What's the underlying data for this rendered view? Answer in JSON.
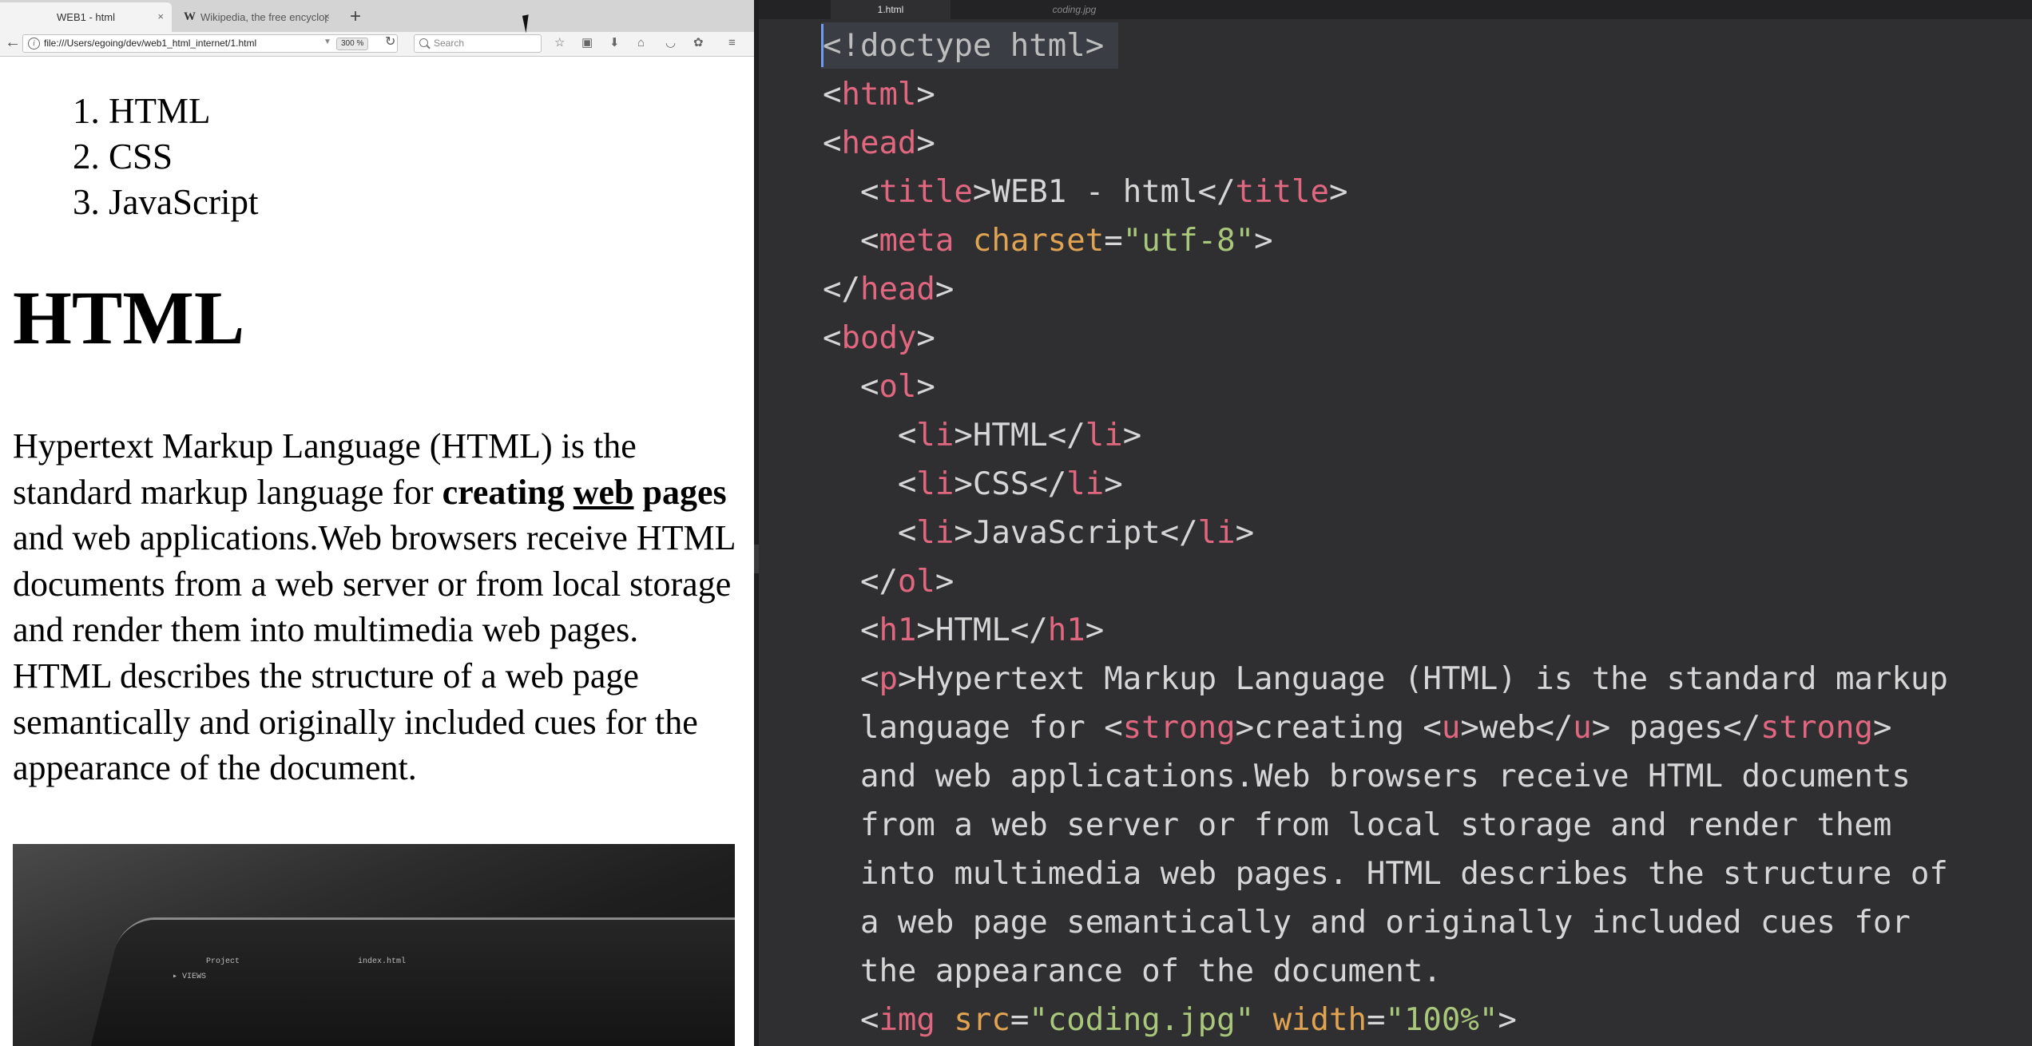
{
  "browser": {
    "tabs": [
      {
        "label": "WEB1 - html",
        "close": "×"
      },
      {
        "label": "Wikipedia, the free encyclope",
        "icon_glyph": "W",
        "close": "×"
      }
    ],
    "new_tab": "+",
    "url": "file:///Users/egoing/dev/web1_html_internet/1.html",
    "zoom": "300 %",
    "search_placeholder": "Search",
    "toolbar_icons": [
      "star-icon",
      "clipboard-icon",
      "download-icon",
      "home-icon",
      "pocket-icon",
      "extension-icon",
      "menu-icon"
    ]
  },
  "page": {
    "list": [
      "HTML",
      "CSS",
      "JavaScript"
    ],
    "heading": "HTML",
    "paragraph": {
      "before": "Hypertext Markup Language (HTML) is the standard markup language for ",
      "strong_before": "creating ",
      "underlined": "web",
      "strong_after": " pages",
      "after": " and web applications.Web browsers receive HTML documents from a web server or from local storage and render them into multimedia web pages. HTML describes the structure of a web page semantically and originally included cues for the appearance of the document."
    },
    "image_screen_text": {
      "project": "Project",
      "file": "index.html",
      "views": "▸ VIEWS"
    }
  },
  "editor": {
    "tabs": [
      {
        "label": "1.html"
      },
      {
        "label": "coding.jpg"
      }
    ],
    "lines": {
      "doctype": "<!doctype html>",
      "title_text": "WEB1 - html",
      "charset_value": "\"utf-8\"",
      "li1": "HTML",
      "li2": "CSS",
      "li3": "JavaScript",
      "h1_text": "HTML",
      "p1": "Hypertext Markup Language (HTML) is the standard markup",
      "p2_a": "language for ",
      "p2_b": "creating ",
      "p2_c": "web",
      "p2_d": " pages",
      "p3": "and web applications.Web browsers receive HTML documents",
      "p4": "from a web server or from local storage and render them",
      "p5": "into multimedia web pages. HTML describes the structure of",
      "p6": "a web page semantically and originally included cues for",
      "p7": "the appearance of the document.",
      "img_src": "\"coding.jpg\"",
      "img_width": "\"100%\""
    }
  },
  "colors": {
    "tag": "#e0677f",
    "attribute": "#e0a352",
    "string": "#a9c77a",
    "text": "#d6d6d6",
    "editor_bg": "#2f2f31"
  }
}
